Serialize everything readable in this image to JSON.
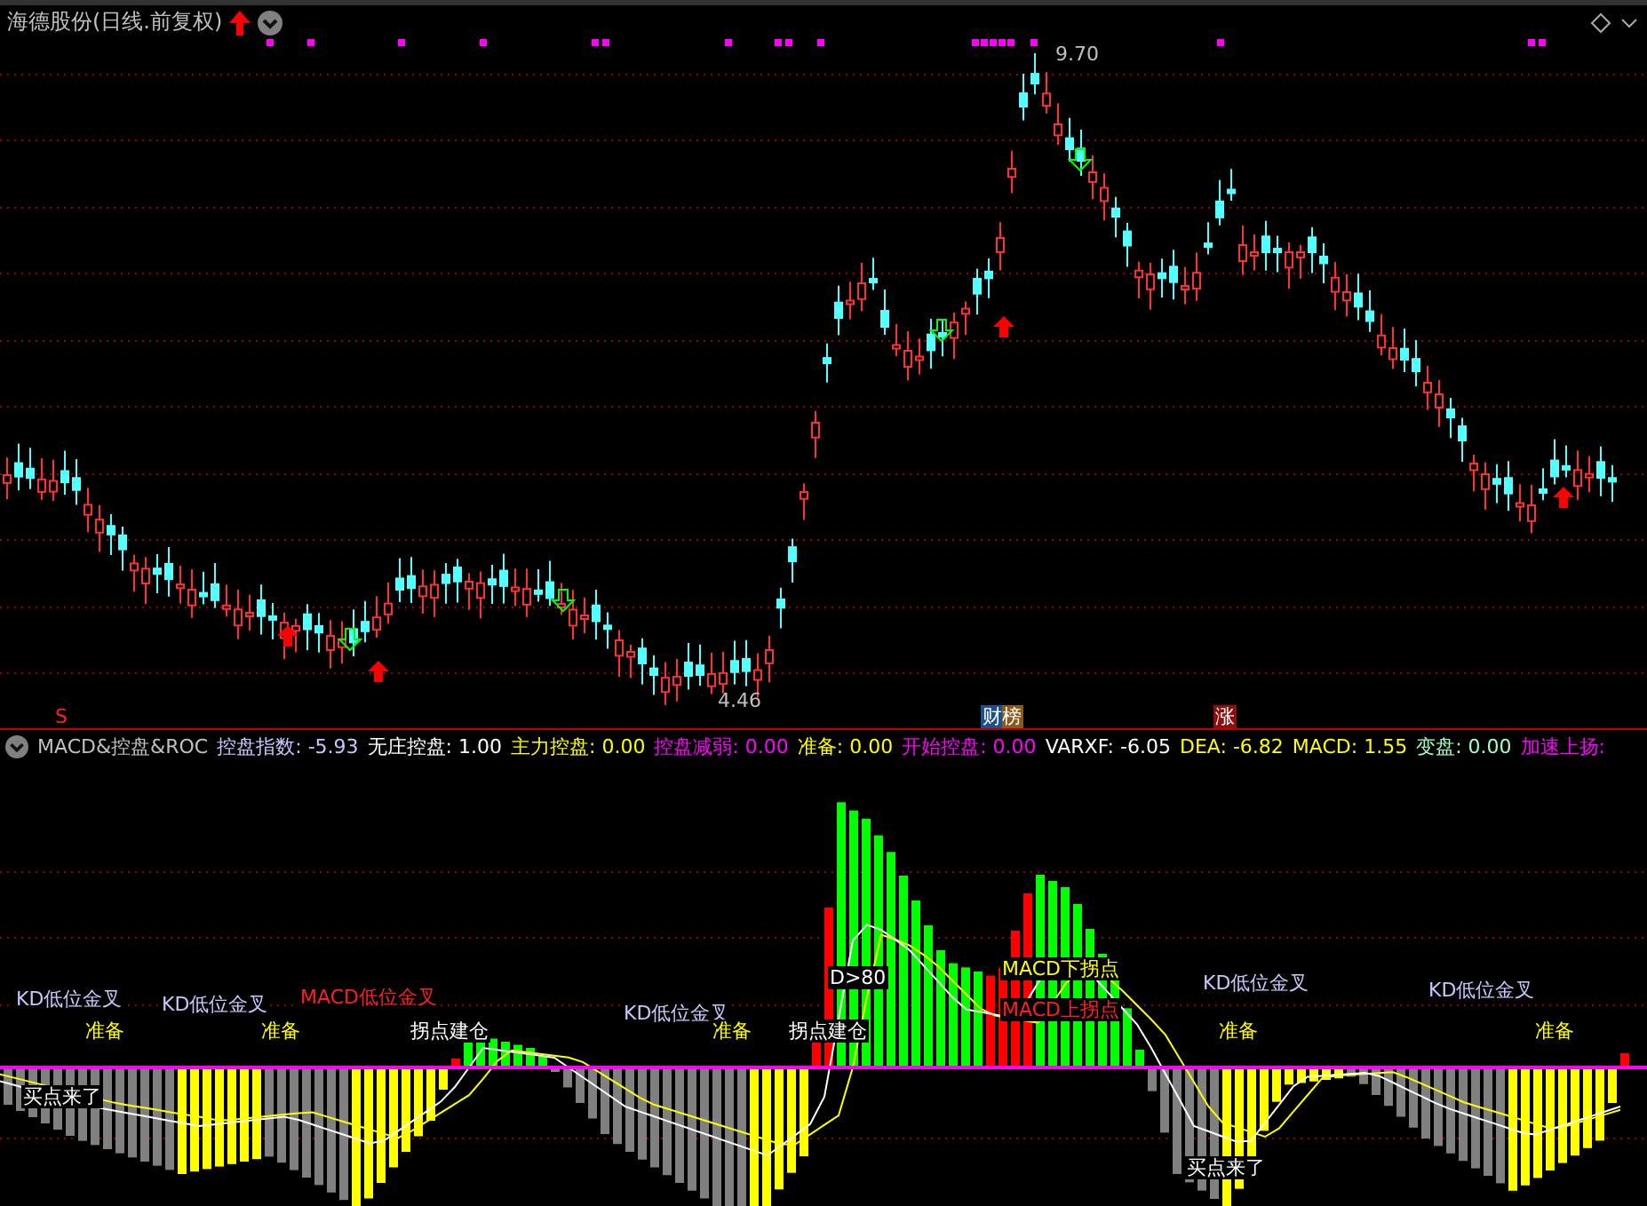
{
  "title_bar": {
    "title": "海德股份(日线.前复权)"
  },
  "price_chart": {
    "high_label": "9.70",
    "low_label": "4.46",
    "markers": [
      {
        "text": "S",
        "kind": "signal"
      },
      {
        "text": "财榜",
        "kind": "news"
      },
      {
        "text": "涨",
        "kind": "limit"
      }
    ]
  },
  "indicator": {
    "name": "MACD&控盘&ROC",
    "readings": [
      {
        "label": "控盘指数:",
        "value": "-5.93",
        "color": "#c8c8ff"
      },
      {
        "label": "无庄控盘:",
        "value": "1.00",
        "color": "#ffffff"
      },
      {
        "label": "主力控盘:",
        "value": "0.00",
        "color": "#ffff00"
      },
      {
        "label": "控盘减弱:",
        "value": "0.00",
        "color": "#ff00ff"
      },
      {
        "label": "准备:",
        "value": "0.00",
        "color": "#ffff00"
      },
      {
        "label": "开始控盘:",
        "value": "0.00",
        "color": "#ff00ff"
      },
      {
        "label": "VARXF:",
        "value": "-6.05",
        "color": "#ffffff"
      },
      {
        "label": "DEA:",
        "value": "-6.82",
        "color": "#ffff00"
      },
      {
        "label": "MACD:",
        "value": "1.55",
        "color": "#ffff00"
      },
      {
        "label": "变盘:",
        "value": "0.00",
        "color": "#a0ffc8"
      },
      {
        "label": "加速上扬:",
        "color": "#ff00ff"
      }
    ],
    "annotations": [
      {
        "text": "KD低位金叉",
        "kind": "kd"
      },
      {
        "text": "买点来了",
        "kind": "buy"
      },
      {
        "text": "准备",
        "kind": "ready"
      },
      {
        "text": "KD低位金叉",
        "kind": "kd"
      },
      {
        "text": "准备",
        "kind": "ready"
      },
      {
        "text": "MACD低位金叉",
        "kind": "macd"
      },
      {
        "text": "拐点建仓",
        "kind": "buy"
      },
      {
        "text": "KD低位金叉",
        "kind": "kd"
      },
      {
        "text": "准备",
        "kind": "ready"
      },
      {
        "text": "拐点建仓",
        "kind": "buy"
      },
      {
        "text": "D>80",
        "kind": "buy"
      },
      {
        "text": "MACD下拐点",
        "kind": "ready"
      },
      {
        "text": "MACD上拐点",
        "kind": "macd"
      },
      {
        "text": "KD低位金叉",
        "kind": "kd"
      },
      {
        "text": "准备",
        "kind": "ready"
      },
      {
        "text": "买点来了",
        "kind": "buy"
      },
      {
        "text": "KD低位金叉",
        "kind": "kd"
      },
      {
        "text": "准备",
        "kind": "ready"
      }
    ]
  }
}
